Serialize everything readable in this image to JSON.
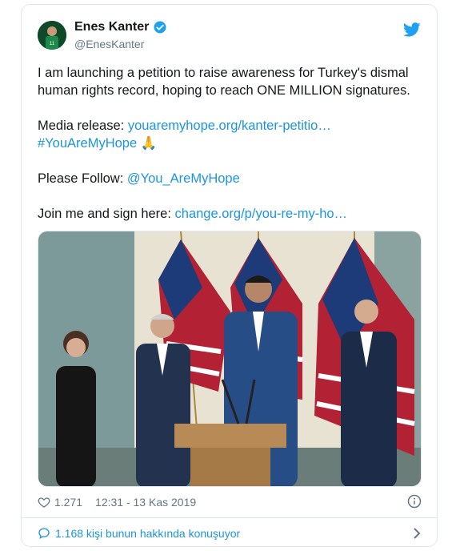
{
  "tweet": {
    "author_name": "Enes Kanter",
    "handle": "@EnesKanter",
    "paragraph1": "I am launching a petition to raise awareness for Turkey's dismal human rights record, hoping to reach ONE MILLION signatures.",
    "media_prefix": "Media release: ",
    "media_link": "youaremyhope.org/kanter-petitio…",
    "hashtag": "#YouAreMyHope",
    "hashtag_emoji": "🙏",
    "follow_prefix": "Please Follow: ",
    "follow_mention": "@You_AreMyHope",
    "sign_prefix": "Join me and sign here: ",
    "sign_link": "change.org/p/you-re-my-ho…",
    "like_count": "1.271",
    "timestamp": "12:31 - 13 Kas 2019",
    "conversation": "1.168 kişi bunun hakkında konuşuyor"
  },
  "icons": {
    "verified": "verified-badge-icon",
    "bird": "twitter-bird-icon",
    "heart": "heart-icon",
    "info": "info-icon",
    "bubble": "speech-bubble-icon",
    "chevron": "chevron-right-icon"
  },
  "colors": {
    "link": "#1b95e0",
    "text": "#14171a",
    "muted": "#657786",
    "border": "#e1e8ed"
  }
}
